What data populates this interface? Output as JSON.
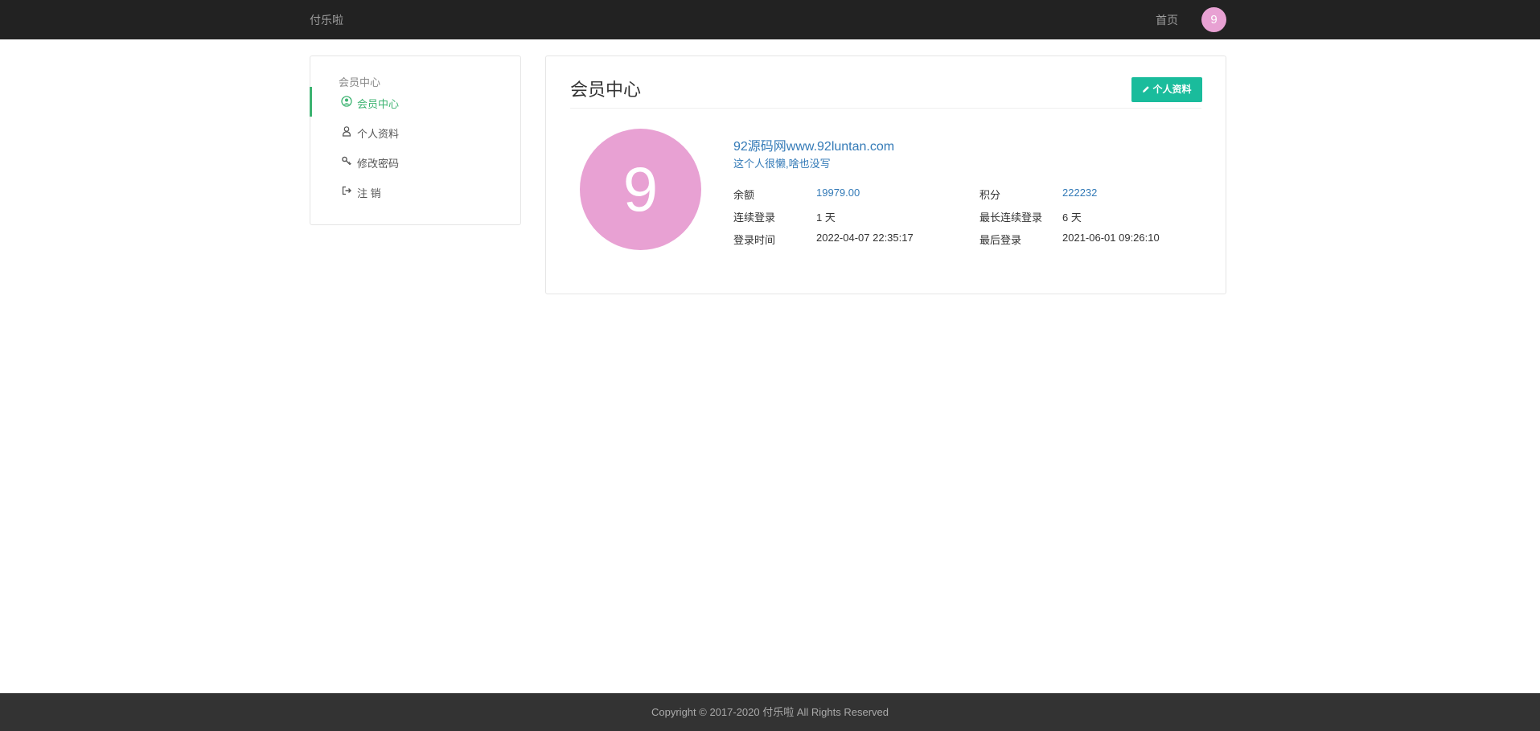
{
  "navbar": {
    "brand": "付乐啦",
    "home_link": "首页",
    "avatar_letter": "9",
    "avatar_color": "#e8a1d3"
  },
  "sidebar": {
    "title": "会员中心",
    "items": [
      {
        "label": "会员中心",
        "icon": "user-circle-icon",
        "active": true
      },
      {
        "label": "个人资料",
        "icon": "user-icon",
        "active": false
      },
      {
        "label": "修改密码",
        "icon": "key-icon",
        "active": false
      },
      {
        "label": "注 销",
        "icon": "sign-out-icon",
        "active": false
      }
    ]
  },
  "main": {
    "title": "会员中心",
    "profile_button": "个人资料",
    "avatar_letter": "9",
    "avatar_color": "#e8a1d3",
    "username": "92源码网www.92luntan.com",
    "signature": "这个人很懒,啥也没写",
    "stats": {
      "balance_label": "余额",
      "balance_value": "19979.00",
      "points_label": "积分",
      "points_value": "222232",
      "consecutive_label": "连续登录",
      "consecutive_value": "1 天",
      "longest_label": "最长连续登录",
      "longest_value": "6 天",
      "login_time_label": "登录时间",
      "login_time_value": "2022-04-07 22:35:17",
      "last_login_label": "最后登录",
      "last_login_value": "2021-06-01 09:26:10"
    }
  },
  "footer": {
    "copyright": "Copyright © 2017-2020 付乐啦 All Rights Reserved"
  },
  "colors": {
    "accent_green": "#3cb371",
    "button_teal": "#1abc9c",
    "link_blue": "#337ab7"
  }
}
